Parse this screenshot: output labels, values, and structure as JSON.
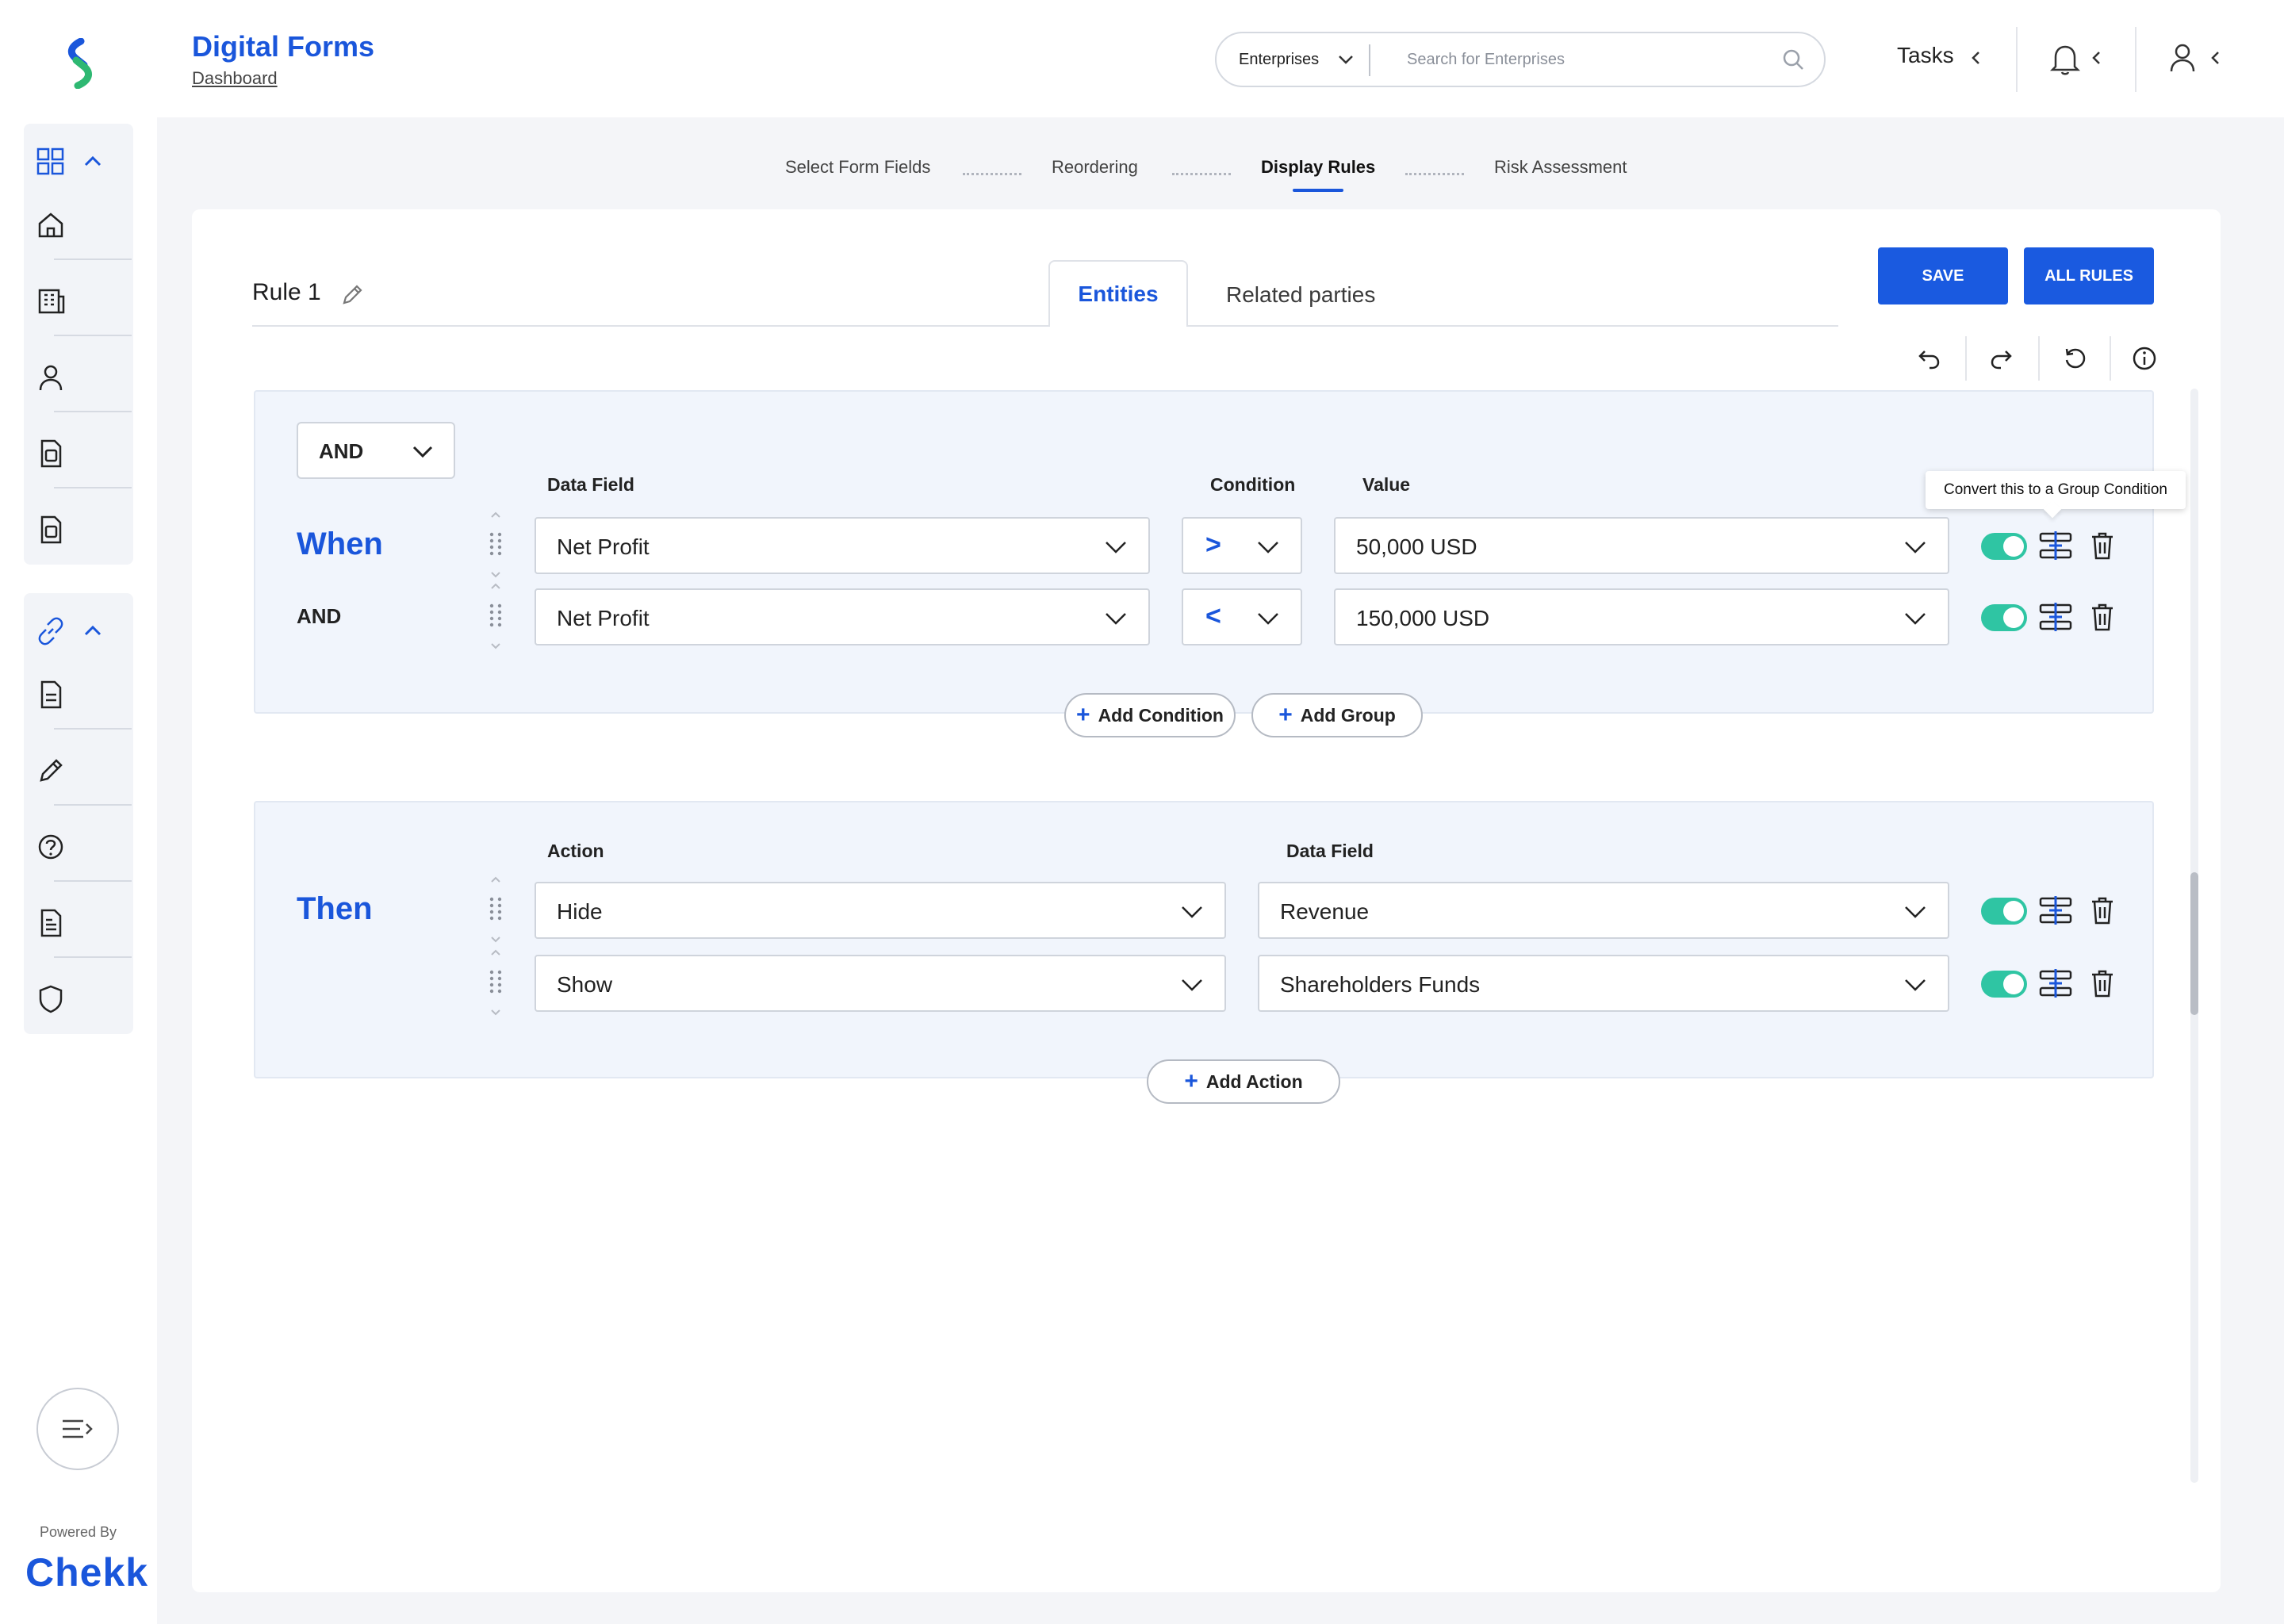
{
  "header": {
    "app_title": "Digital Forms",
    "breadcrumb": "Dashboard",
    "search_scope": "Enterprises",
    "search_placeholder": "Search for Enterprises",
    "tasks_label": "Tasks"
  },
  "sidebar": {
    "groups": [
      {
        "icon": "grid-icon",
        "items": [
          "home-icon",
          "building-icon",
          "user-icon",
          "document-icon",
          "document-icon"
        ]
      },
      {
        "icon": "link-icon",
        "items": [
          "file-icon",
          "pencil-icon",
          "help-icon",
          "report-icon",
          "shield-icon"
        ]
      }
    ],
    "powered_by": "Powered By",
    "brand": "Chekk"
  },
  "steps": [
    {
      "label": "Select Form Fields",
      "active": false
    },
    {
      "label": "Reordering",
      "active": false
    },
    {
      "label": "Display Rules",
      "active": true
    },
    {
      "label": "Risk Assessment",
      "active": false
    }
  ],
  "rule": {
    "title": "Rule 1",
    "tabs": [
      "Entities",
      "Related parties"
    ],
    "active_tab": "Entities",
    "save_label": "SAVE",
    "all_rules_label": "ALL RULES"
  },
  "when": {
    "group_operator": "AND",
    "col_data_field": "Data Field",
    "col_condition": "Condition",
    "col_value": "Value",
    "label": "When",
    "rows": [
      {
        "prefix": "When",
        "field": "Net Profit",
        "operator": ">",
        "value": "50,000 USD",
        "enabled": true
      },
      {
        "prefix": "AND",
        "field": "Net Profit",
        "operator": "<",
        "value": "150,000 USD",
        "enabled": true
      }
    ],
    "tooltip": "Convert this to a Group Condition",
    "add_condition_label": "Add Condition",
    "add_group_label": "Add Group"
  },
  "then": {
    "label": "Then",
    "col_action": "Action",
    "col_data_field": "Data Field",
    "rows": [
      {
        "action": "Hide",
        "field": "Revenue",
        "enabled": true
      },
      {
        "action": "Show",
        "field": "Shareholders Funds",
        "enabled": true
      }
    ],
    "add_action_label": "Add Action"
  },
  "colors": {
    "accent": "#1a56db",
    "toggle_on": "#2fc5a3",
    "section_bg": "#f1f5fc"
  }
}
